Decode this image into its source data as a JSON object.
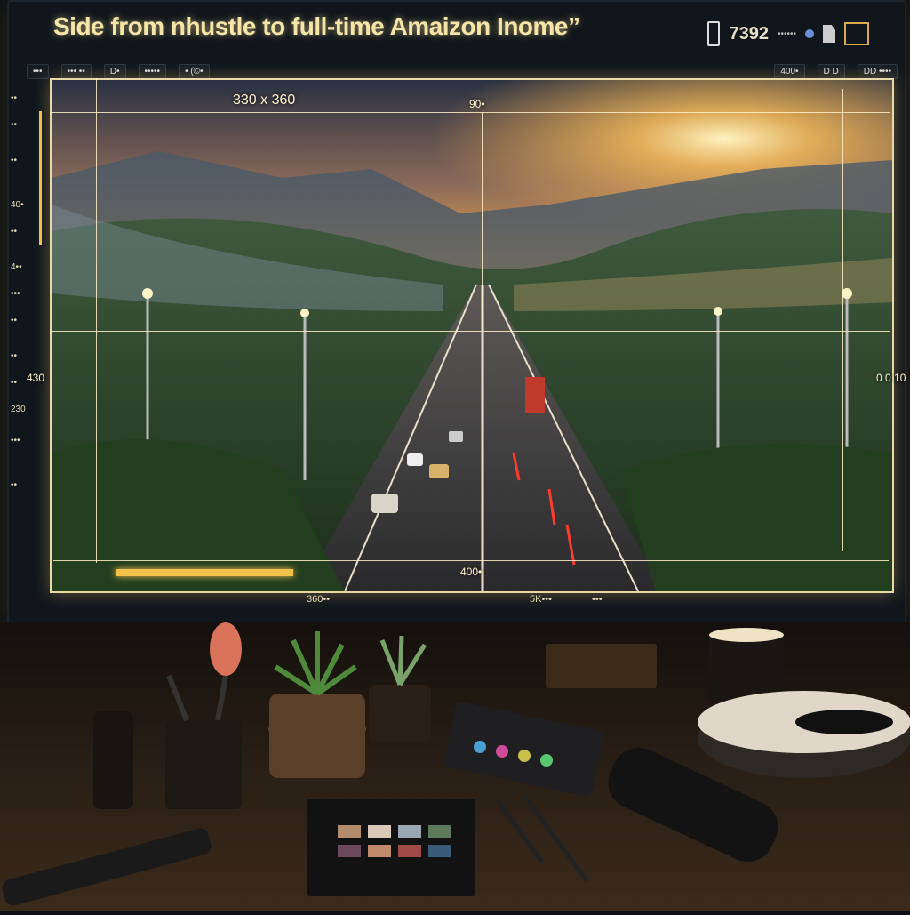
{
  "app": {
    "title": "Side from nhustle to full-time Amaizon Inome”"
  },
  "status": {
    "number": "7392",
    "small_text": "••••••"
  },
  "toolbar": {
    "items": [
      "•••",
      "••• ••",
      "D•",
      "•••••",
      "• (©•",
      "D  D",
      "DD ••••"
    ],
    "right_label": "400•"
  },
  "canvas": {
    "size_label": "330 x 360",
    "top_mark": "90•",
    "left_mark": "430",
    "right_mark": "0 0 10",
    "bottom_mark": "400•",
    "bottom_left_label": "360••",
    "bottom_mid_label": "5K•••",
    "bottom_right_label": "•••"
  },
  "ruler": {
    "marks": [
      "••",
      "••",
      "••",
      "40•",
      "••",
      "4••",
      "•••",
      "••",
      "••",
      "••",
      "230",
      "•••",
      "••"
    ]
  },
  "colors": {
    "accent": "#f2c14c",
    "frame": "#e9d9a4",
    "sky_sun": "#ffb347"
  },
  "icons": {
    "phone": "phone-icon",
    "dot": "settings-dot-icon",
    "doc": "document-icon",
    "image": "image-icon"
  }
}
